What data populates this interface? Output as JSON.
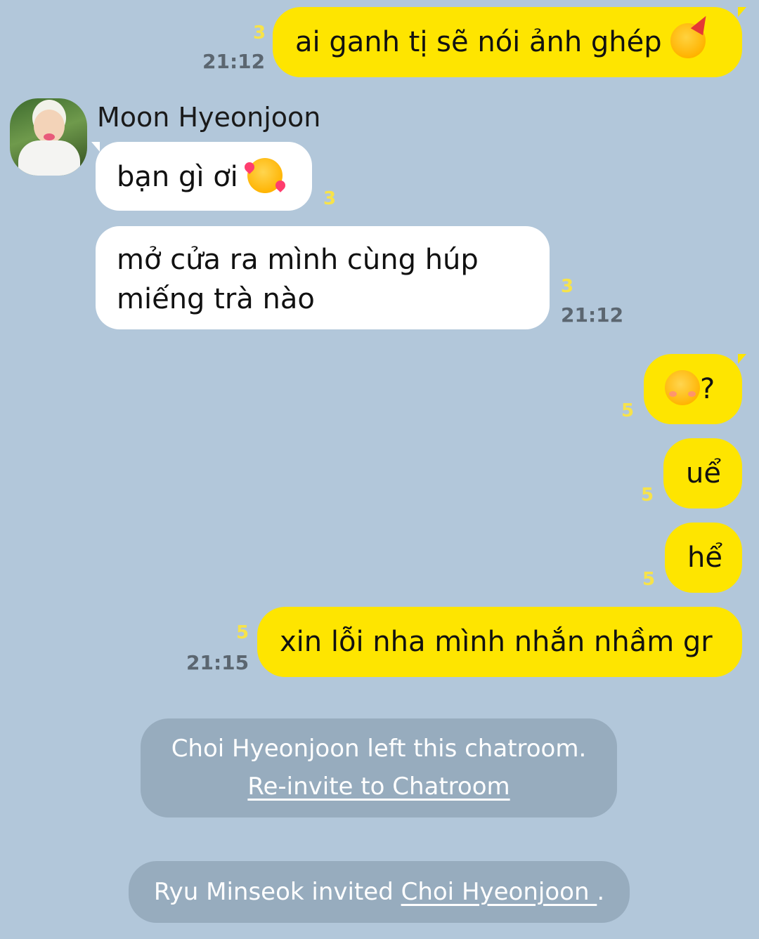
{
  "messages": [
    {
      "id": "m1",
      "text": "ai ganh tị sẽ nói ảnh ghép",
      "emoji": "partying-face-emoji",
      "unread": "3",
      "time": "21:12"
    },
    {
      "id": "m2",
      "sender": "Moon Hyeonjoon",
      "text": "bạn gì ơi",
      "emoji": "smiling-face-with-hearts-emoji",
      "unread": "3"
    },
    {
      "id": "m3",
      "line1": "mở cửa ra mình cùng húp",
      "line2": "miếng trà nào",
      "unread": "3",
      "time": "21:12"
    },
    {
      "id": "m4",
      "text": "?",
      "emoji": "smiling-face-emoji",
      "unread": "5"
    },
    {
      "id": "m5",
      "text": "uể",
      "unread": "5"
    },
    {
      "id": "m6",
      "text": "hể",
      "unread": "5"
    },
    {
      "id": "m7",
      "text": "xin lỗi nha mình nhắn nhầm gr",
      "unread": "5",
      "time": "21:15"
    }
  ],
  "notices": {
    "left": {
      "text": "Choi Hyeonjoon left this chatroom.",
      "link": "Re-invite to Chatroom"
    },
    "invited": {
      "prefix": "Ryu Minseok invited ",
      "link": "Choi Hyeonjoon ",
      "suffix": "."
    }
  },
  "colors": {
    "background": "#b2c7da",
    "my_bubble": "#fee500",
    "other_bubble": "#ffffff",
    "unread_count": "#f7e34a",
    "time": "#5b6670"
  }
}
